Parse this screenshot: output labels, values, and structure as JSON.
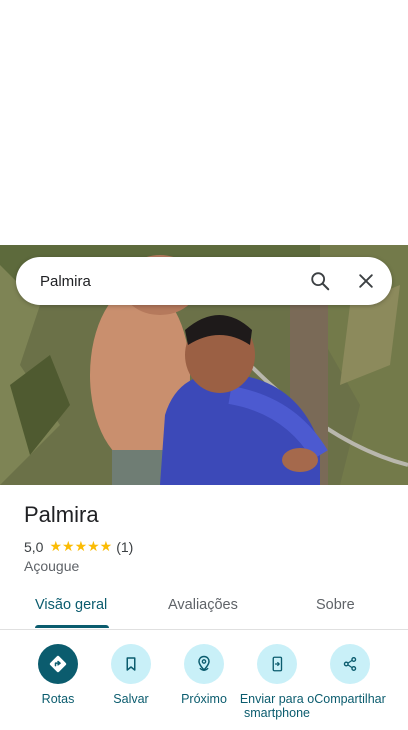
{
  "search": {
    "query": "Palmira"
  },
  "photo": {
    "description_icon": "place-photo"
  },
  "place": {
    "name": "Palmira",
    "rating_value": "5,0",
    "rating_stars": "★★★★★",
    "rating_fraction": 1.0,
    "review_count": "(1)",
    "category": "Açougue"
  },
  "tabs": [
    {
      "label": "Visão geral",
      "active": true
    },
    {
      "label": "Avaliações",
      "active": false
    },
    {
      "label": "Sobre",
      "active": false
    }
  ],
  "actions": [
    {
      "label": "Rotas",
      "icon": "directions-icon"
    },
    {
      "label": "Salvar",
      "icon": "bookmark-icon"
    },
    {
      "label": "Próximo",
      "icon": "nearby-icon"
    },
    {
      "label": "Enviar para o smartphone",
      "icon": "send-to-phone-icon"
    },
    {
      "label": "Compartilhar",
      "icon": "share-icon"
    }
  ],
  "colors": {
    "accent": "#0b5c6e",
    "action_bg": "#c9f0f8",
    "star": "#fbbc04"
  }
}
